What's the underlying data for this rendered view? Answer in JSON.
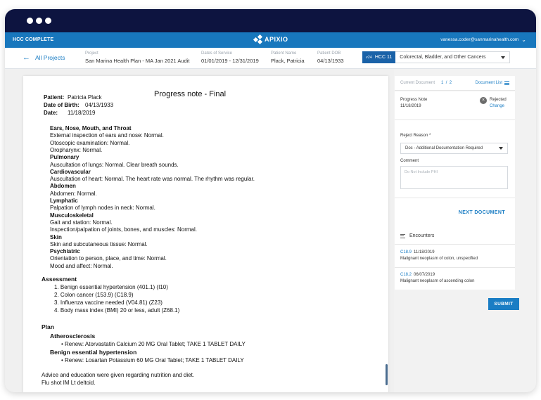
{
  "app": {
    "brand": "HCC COMPLETE",
    "logo_text": "APIXIO",
    "user_email": "vanessa.coder@sanmarinahealth.com"
  },
  "nav": {
    "back_label": "All Projects"
  },
  "meta": [
    {
      "label": "Project",
      "value": "San Marina Health Plan - MA Jan 2021 Audit"
    },
    {
      "label": "Dates of Service",
      "value": "01/01/2019 - 12/31/2019"
    },
    {
      "label": "Patient Name",
      "value": "Plack, Patricia"
    },
    {
      "label": "Patient DOB",
      "value": "04/13/1933"
    }
  ],
  "hcc": {
    "version": "v24",
    "code": "HCC 11",
    "description": "Colorectal, Bladder, and Other Cancers"
  },
  "document": {
    "title": "Progress note - Final",
    "patient_label": "Patient:",
    "patient_value": "Patricia Plack",
    "dob_label": "Date of Birth:",
    "dob_value": "04/13/1933",
    "date_label": "Date:",
    "date_value": "11/18/2019",
    "exam": [
      {
        "kind": "h",
        "text": "Ears, Nose, Mouth, and Throat"
      },
      {
        "kind": "t",
        "text": "External inspection of ears and nose: Normal."
      },
      {
        "kind": "t",
        "text": "Otoscopic examination: Normal."
      },
      {
        "kind": "t",
        "text": "Oropharynx: Normal."
      },
      {
        "kind": "h",
        "text": "Pulmonary"
      },
      {
        "kind": "t",
        "text": "Auscultation of lungs: Normal. Clear breath sounds."
      },
      {
        "kind": "h",
        "text": "Cardiovascular"
      },
      {
        "kind": "t",
        "text": "Auscultation of heart: Normal. The heart rate was normal. The rhythm was regular."
      },
      {
        "kind": "h",
        "text": "Abdomen"
      },
      {
        "kind": "t",
        "text": "Abdomen: Normal."
      },
      {
        "kind": "h",
        "text": "Lymphatic"
      },
      {
        "kind": "t",
        "text": "Palpation of lymph nodes in neck: Normal."
      },
      {
        "kind": "h",
        "text": "Musculoskeletal"
      },
      {
        "kind": "t",
        "text": "Gait and station: Normal."
      },
      {
        "kind": "t",
        "text": "Inspection/palpation of joints, bones, and muscles: Normal."
      },
      {
        "kind": "h",
        "text": "Skin"
      },
      {
        "kind": "t",
        "text": "Skin and subcutaneous tissue: Normal."
      },
      {
        "kind": "h",
        "text": "Psychiatric"
      },
      {
        "kind": "t",
        "text": "Orientation to person, place, and time: Normal."
      },
      {
        "kind": "t",
        "text": "Mood and affect: Normal."
      }
    ],
    "assessment_heading": "Assessment",
    "assessment": [
      "1. Benign essential hypertension (401.1) (I10)",
      "2. Colon cancer (153.9) (C18.9)",
      "3. Influenza vaccine needed (V04.81) (Z23)",
      "4. Body mass index (BMI) 20 or less, adult (Z68.1)"
    ],
    "plan_heading": "Plan",
    "plan_sub1": "Atherosclerosis",
    "plan_item1": "• Renew: Atorvastatin Calcium 20 MG Oral Tablet; TAKE 1 TABLET DAILY",
    "plan_sub2": "Benign essential hypertension",
    "plan_item2": "• Renew: Losartan Potassium 60 MG Oral Tablet; TAKE 1 TABLET DAILY",
    "footer1": "Advice and education were given regarding nutrition and diet.",
    "footer2": "Flu shot IM Lt deltoid."
  },
  "panel": {
    "current_doc_label": "Current Document",
    "current_index": "1",
    "separator": "/",
    "total": "2",
    "doc_list_label": "Document List",
    "doc_type": "Progress Note",
    "doc_date": "11/18/2019",
    "status": "Rejected",
    "change_label": "Change",
    "reject_reason_label": "Reject Reason *",
    "reject_reason_value": "Doc - Additional Documentation Required",
    "comment_label": "Comment",
    "comment_placeholder": "Do Not Include PHI",
    "next_label": "NEXT DOCUMENT",
    "encounters_label": "Encounters",
    "encounters": [
      {
        "code": "C18.9",
        "date": "11/18/2019",
        "desc": "Malignant neoplasm of colon, unspecified"
      },
      {
        "code": "C18.2",
        "date": "06/07/2019",
        "desc": "Malignant neoplasm of ascending colon"
      }
    ],
    "submit_label": "SUBMIT"
  },
  "colors": {
    "chrome": "#0d1440",
    "topbar": "#1877bd",
    "accent": "#1a7dc4",
    "hcc_tag": "#1a62a8"
  },
  "icons": [
    "back-arrow-icon",
    "chevron-down-icon",
    "close-icon",
    "list-icon",
    "dropdown-icon"
  ]
}
